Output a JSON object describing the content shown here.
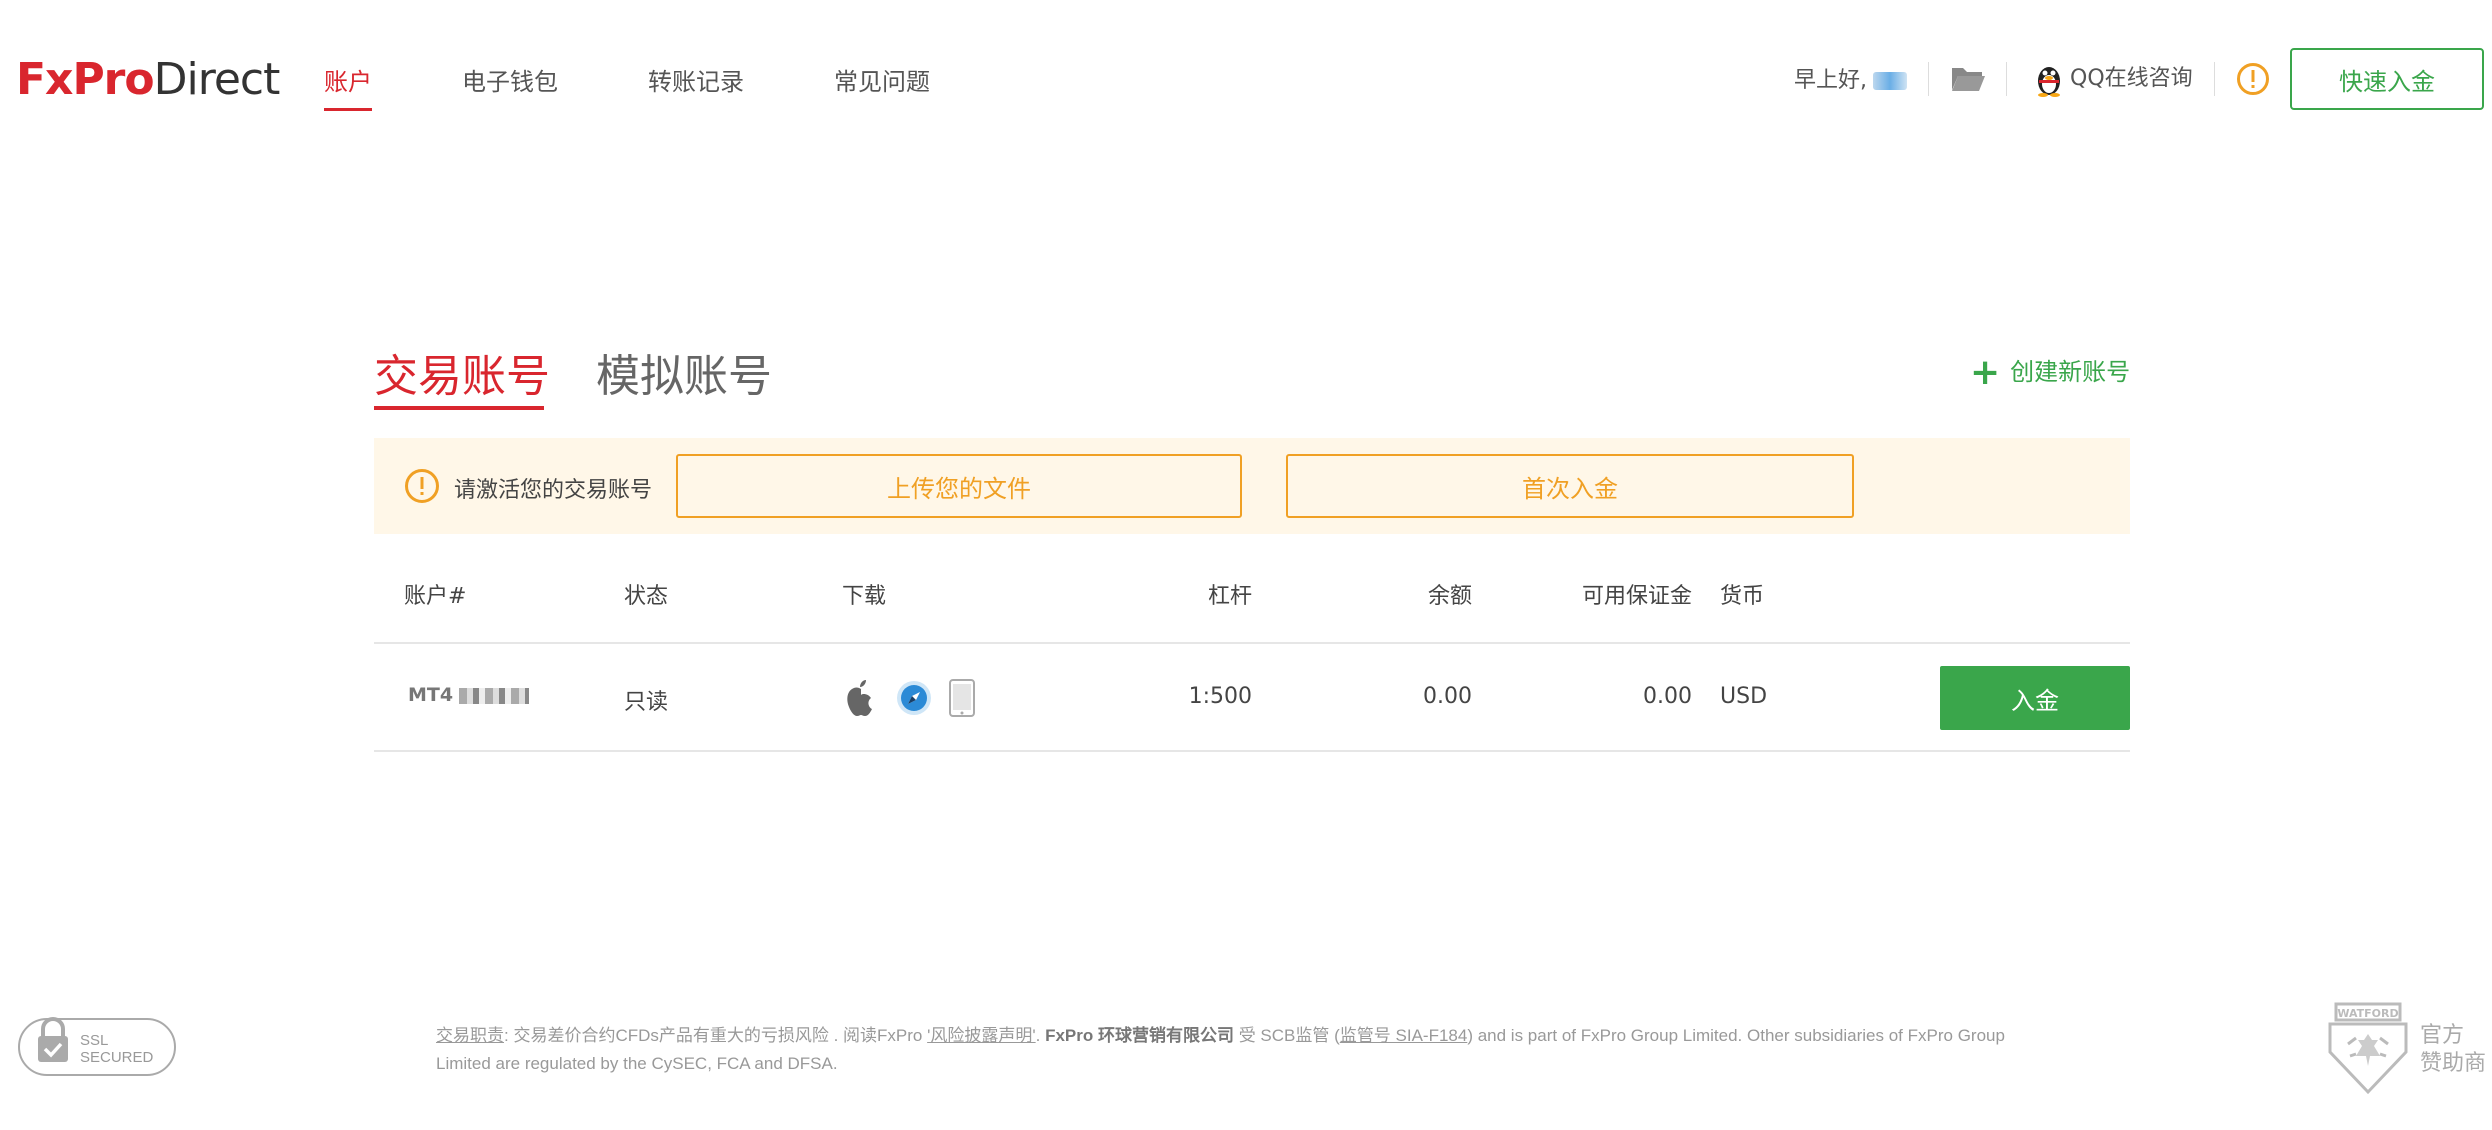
{
  "header": {
    "logo_fx": "FxPro",
    "logo_direct": "Direct",
    "nav": [
      {
        "label": "账户"
      },
      {
        "label": "电子钱包"
      },
      {
        "label": "转账记录"
      },
      {
        "label": "常见问题"
      }
    ],
    "greeting": "早上好,",
    "qq_label": "QQ在线咨询",
    "quick_deposit": "快速入金"
  },
  "tabs": {
    "trading": "交易账号",
    "demo": "模拟账号",
    "create_new": "创建新账号"
  },
  "notice": {
    "text": "请激活您的交易账号",
    "upload_button": "上传您的文件",
    "first_deposit_button": "首次入金"
  },
  "table": {
    "headers": {
      "account": "账户#",
      "status": "状态",
      "download": "下载",
      "leverage": "杠杆",
      "balance": "余额",
      "free_margin": "可用保证金",
      "currency": "货币"
    },
    "rows": [
      {
        "account_prefix": "MT4",
        "status": "只读",
        "leverage": "1:500",
        "balance": "0.00",
        "free_margin": "0.00",
        "currency": "USD",
        "deposit_button": "入金"
      }
    ]
  },
  "footer": {
    "ssl_line1": "SSL",
    "ssl_line2": "SECURED",
    "risk_link": "交易职责",
    "text1": ": 交易差价合约CFDs产品有重大的亏损风险 . 阅读FxPro ",
    "risk_disclosure_link": "'风险披露声明'",
    "text2": ". ",
    "company": "FxPro 环球营销有限公司",
    "text3": " 受 SCB监管 (",
    "license_link": "监管号 SIA-F184",
    "text4": ") and is part of FxPro Group Limited. Other subsidiaries of FxPro Group Limited are regulated by the CySEC, FCA and DFSA.",
    "sponsor_line1": "官方",
    "sponsor_line2": "赞助商",
    "watford_label": "WATFORD"
  }
}
